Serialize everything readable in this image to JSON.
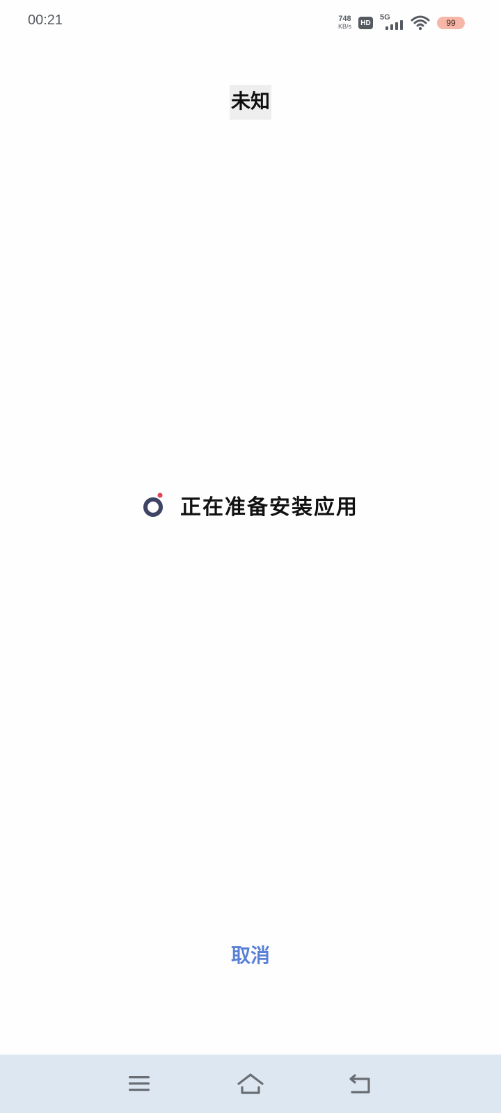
{
  "status_bar": {
    "time": "00:21",
    "net_speed_value": "748",
    "net_speed_unit": "KB/s",
    "hd_label": "HD",
    "network_type": "5G",
    "battery_level": "99",
    "icons": [
      "hd-icon",
      "signal-icon",
      "wifi-icon",
      "battery-icon"
    ]
  },
  "header": {
    "title": "未知"
  },
  "main": {
    "loading_message": "正在准备安装应用",
    "spinner_icon": "loading-spinner-icon"
  },
  "actions": {
    "cancel_label": "取消"
  },
  "nav_bar": {
    "icons": [
      "menu-icon",
      "home-icon",
      "back-icon"
    ]
  },
  "colors": {
    "accent": "#5a80d6",
    "spinner_ring": "#3e4463",
    "spinner_dot": "#e0485a",
    "nav_background": "#dde7f1",
    "battery_background": "#f7b7a8"
  }
}
